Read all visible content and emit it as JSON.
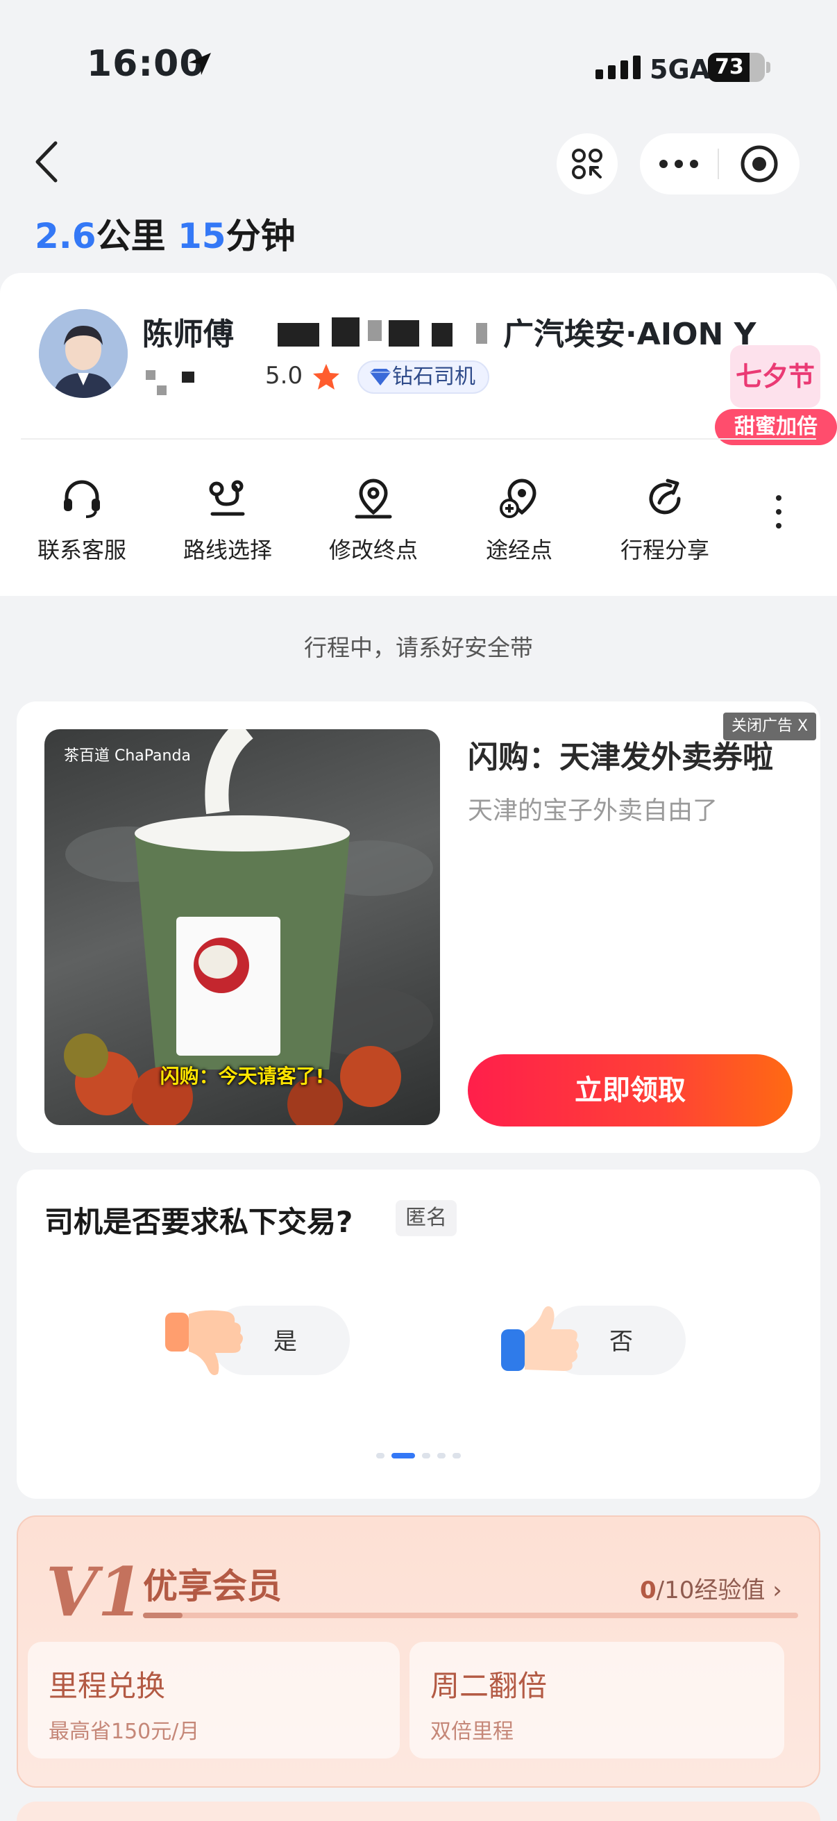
{
  "status_bar": {
    "time": "16:00",
    "network": "5GA",
    "battery": "73",
    "battery_level": 0.73
  },
  "nav": {
    "back": "back-icon",
    "pin": "pin-share-icon",
    "more": "more-dots-icon",
    "target": "target-icon"
  },
  "trip": {
    "distance_value": "2.6",
    "distance_unit": "公里",
    "time_value": "15",
    "time_unit": "分钟"
  },
  "driver": {
    "name": "陈师傅",
    "car_model": "广汽埃安·AION Y",
    "rating": "5.0",
    "badge": "钻石司机",
    "festival_top": "七夕节",
    "festival_bottom": "甜蜜加倍"
  },
  "actions": [
    {
      "label": "联系客服",
      "icon": "headset-icon"
    },
    {
      "label": "路线选择",
      "icon": "route-icon"
    },
    {
      "label": "修改终点",
      "icon": "location-pin-icon"
    },
    {
      "label": "途经点",
      "icon": "waypoint-icon"
    },
    {
      "label": "行程分享",
      "icon": "share-icon"
    }
  ],
  "notice": "行程中，请系好安全带",
  "ad": {
    "close": "关闭广告 X",
    "brand": "茶百道 ChaPanda",
    "image_caption": "闪购：今天请客了!",
    "title": "闪购：天津发外卖券啦",
    "subtitle": "天津的宝子外卖自由了",
    "cta": "立即领取"
  },
  "survey": {
    "question": "司机是否要求私下交易?",
    "anon": "匿名",
    "yes": "是",
    "no": "否",
    "page_index": 1,
    "page_count": 5
  },
  "member": {
    "level": "V1",
    "title": "优享会员",
    "exp_current": "0",
    "exp_total": "/10经验值 ›",
    "progress": 0.06,
    "benefits": [
      {
        "title": "里程兑换",
        "sub": "最高省150元/月"
      },
      {
        "title": "周二翻倍",
        "sub": "双倍里程"
      }
    ]
  },
  "colors": {
    "accent": "#3478f6",
    "cta": "#ff2d4b",
    "member": "#b35a44"
  }
}
